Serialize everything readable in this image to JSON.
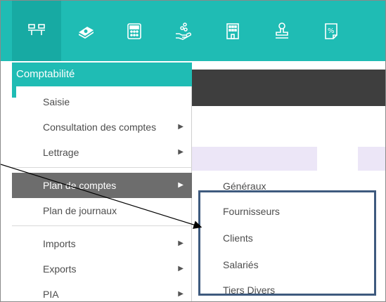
{
  "toolbar": {
    "icons": [
      "accounting-icon",
      "money-icon",
      "calculator-icon",
      "hand-coins-icon",
      "building-icon",
      "stamp-icon",
      "percent-document-icon"
    ]
  },
  "menu": {
    "header": "Comptabilité",
    "items": [
      {
        "label": "Saisie",
        "has_submenu": false
      },
      {
        "label": "Consultation des comptes",
        "has_submenu": true
      },
      {
        "label": "Lettrage",
        "has_submenu": true
      },
      {
        "label": "Plan de comptes",
        "has_submenu": true,
        "active": true
      },
      {
        "label": "Plan de journaux",
        "has_submenu": false
      },
      {
        "label": "Imports",
        "has_submenu": true
      },
      {
        "label": "Exports",
        "has_submenu": true
      },
      {
        "label": "PIA",
        "has_submenu": true
      }
    ],
    "arrow_glyph": "▶"
  },
  "submenu": {
    "items": [
      "Généraux",
      "Fournisseurs",
      "Clients",
      "Salariés",
      "Tiers Divers"
    ]
  },
  "colors": {
    "teal": "#1fbcb4",
    "active_item": "#6d6d6d",
    "highlight_border": "#3e5a7e",
    "dark_band": "#3e3e3e",
    "lavender": "#ece6f7"
  }
}
